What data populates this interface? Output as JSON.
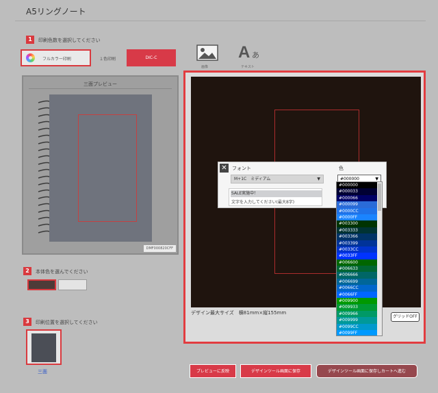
{
  "header": {
    "title": "A5リングノート"
  },
  "steps": [
    {
      "num": "1",
      "text": "印刷色数を選択してください"
    },
    {
      "num": "2",
      "text": "本体色を選んでください"
    },
    {
      "num": "3",
      "text": "印刷位置を選択してください"
    }
  ],
  "print_options": {
    "fullcolor": "フルカラー印刷",
    "onecolor": "１色印刷",
    "dic": "DIC-C"
  },
  "tools": {
    "image": "画像",
    "text": "テキスト"
  },
  "preview": {
    "title": "三面プレビュー",
    "caption": "DMF000820CFF"
  },
  "position": {
    "label": "三面"
  },
  "canvas": {
    "caption": "デザイン最大サイズ　横81mm×縦155mm",
    "grid_button": "グリッドOFF"
  },
  "font_panel": {
    "font_label": "フォント",
    "color_label": "色",
    "font_value": "M+1C　ミディアム",
    "color_value": "#000000",
    "text_line1": "SALE実施中！",
    "text_line2": "文字を入力してください(最大8字)"
  },
  "color_options": [
    {
      "label": "#000000",
      "hex": "#000000"
    },
    {
      "label": "#000033",
      "hex": "#000033"
    },
    {
      "label": "#000066",
      "hex": "#000066"
    },
    {
      "label": "#000099",
      "hex": "#2a6bd8"
    },
    {
      "label": "#0000CC",
      "hex": "#1f72e8"
    },
    {
      "label": "#0000FF",
      "hex": "#1a84ff"
    },
    {
      "label": "#003300",
      "hex": "#003300"
    },
    {
      "label": "#003333",
      "hex": "#003333"
    },
    {
      "label": "#003366",
      "hex": "#003366"
    },
    {
      "label": "#003399",
      "hex": "#003399"
    },
    {
      "label": "#0033CC",
      "hex": "#0033cc"
    },
    {
      "label": "#0033FF",
      "hex": "#0033ff"
    },
    {
      "label": "#006600",
      "hex": "#006600"
    },
    {
      "label": "#006633",
      "hex": "#006633"
    },
    {
      "label": "#006666",
      "hex": "#006666"
    },
    {
      "label": "#006699",
      "hex": "#006699"
    },
    {
      "label": "#0066CC",
      "hex": "#0066cc"
    },
    {
      "label": "#0066FF",
      "hex": "#0066ff"
    },
    {
      "label": "#009900",
      "hex": "#009900"
    },
    {
      "label": "#009933",
      "hex": "#009933"
    },
    {
      "label": "#009966",
      "hex": "#009966"
    },
    {
      "label": "#009999",
      "hex": "#009999"
    },
    {
      "label": "#0099CC",
      "hex": "#0099cc"
    },
    {
      "label": "#0099FF",
      "hex": "#0099ff"
    }
  ],
  "body_colors": {
    "dark": "#4e3b38",
    "white": "#e4e4e4"
  },
  "buttons": {
    "add": "プレビューに反映",
    "save": "デザインツール画面に保存",
    "cart": "デザインツール画面に保存しカートへ進む"
  },
  "colors": {
    "accent": "#d9393e",
    "canvas_bg": "#1f140e"
  }
}
